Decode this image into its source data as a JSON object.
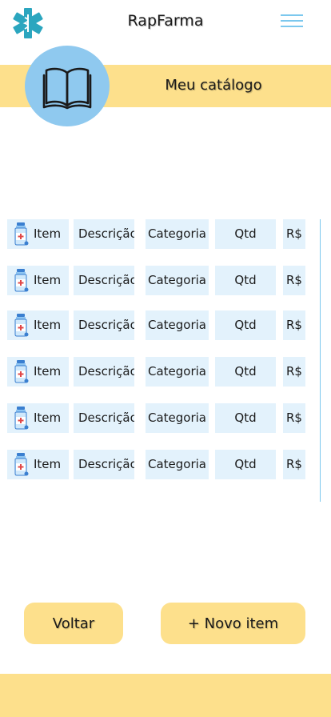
{
  "header": {
    "app_title": "RapFarma",
    "logo_icon": "medical-star-of-life-icon",
    "menu_icon": "hamburger-menu-icon",
    "accent_color": "#2ba6bf"
  },
  "banner": {
    "title": "Meu catálogo",
    "icon": "open-book-icon",
    "banner_color": "#fde08c",
    "circle_color": "#8fc9ef"
  },
  "table": {
    "item_icon": "medicine-bottle-icon",
    "rows": [
      {
        "item": "Item",
        "descricao": "Descrição",
        "categoria": "Categoria",
        "qtd": "Qtd",
        "preco": "R$"
      },
      {
        "item": "Item",
        "descricao": "Descrição",
        "categoria": "Categoria",
        "qtd": "Qtd",
        "preco": "R$"
      },
      {
        "item": "Item",
        "descricao": "Descrição",
        "categoria": "Categoria",
        "qtd": "Qtd",
        "preco": "R$"
      },
      {
        "item": "Item",
        "descricao": "Descrição",
        "categoria": "Categoria",
        "qtd": "Qtd",
        "preco": "R$"
      },
      {
        "item": "Item",
        "descricao": "Descrição",
        "categoria": "Categoria",
        "qtd": "Qtd",
        "preco": "R$"
      },
      {
        "item": "Item",
        "descricao": "Descrição",
        "categoria": "Categoria",
        "qtd": "Qtd",
        "preco": "R$"
      }
    ]
  },
  "actions": {
    "back_label": "Voltar",
    "new_item_label": "+ Novo item"
  }
}
